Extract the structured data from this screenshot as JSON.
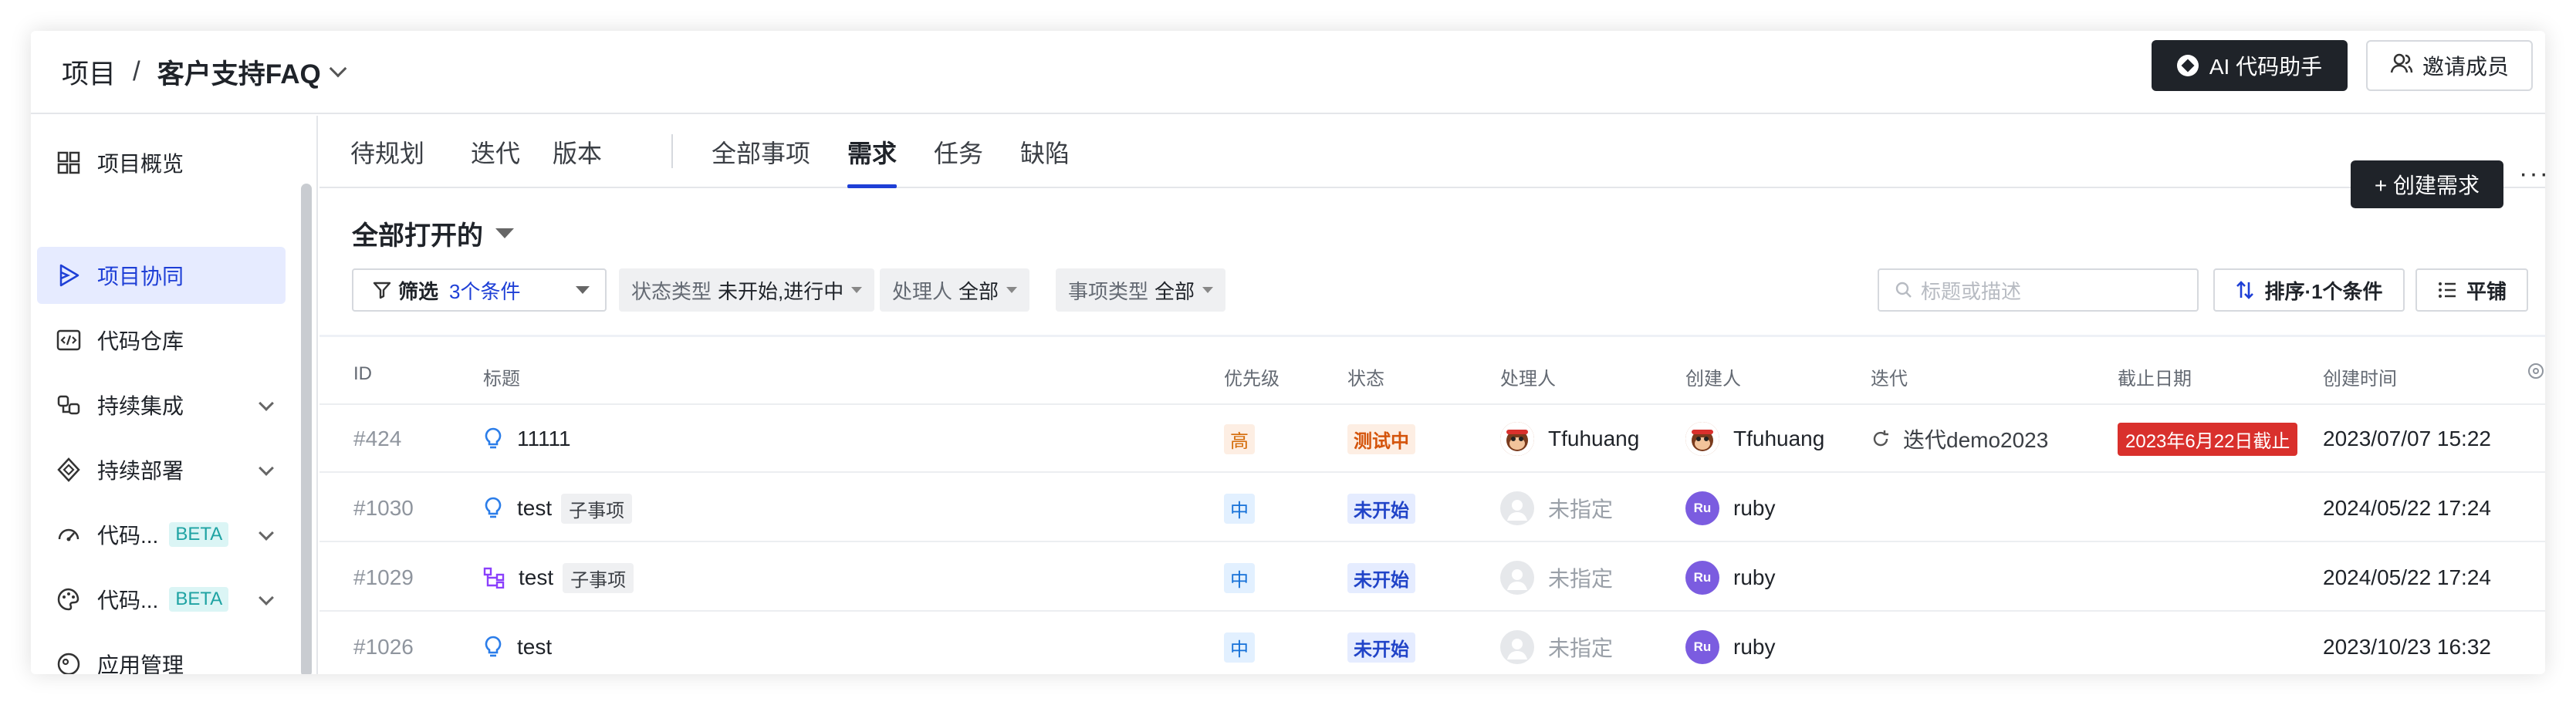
{
  "breadcrumb": {
    "root": "项目",
    "separator": "/",
    "project": "客户支持FAQ"
  },
  "header": {
    "ai_button": "AI 代码助手",
    "invite_button": "邀请成员"
  },
  "sidebar": {
    "items": [
      {
        "label": "项目概览",
        "icon": "grid-icon"
      },
      {
        "label": "项目协同",
        "icon": "collab-icon",
        "active": true
      },
      {
        "label": "代码仓库",
        "icon": "code-icon"
      },
      {
        "label": "持续集成",
        "icon": "ci-icon"
      },
      {
        "label": "持续部署",
        "icon": "cd-icon"
      },
      {
        "label": "代码...",
        "icon": "gauge-icon",
        "badge": "BETA"
      },
      {
        "label": "代码...",
        "icon": "palette-icon",
        "badge": "BETA"
      },
      {
        "label": "应用管理",
        "icon": "app-icon"
      }
    ]
  },
  "tabs": [
    {
      "label": "待规划"
    },
    {
      "label": "迭代"
    },
    {
      "label": "版本"
    },
    {
      "label": "全部事项"
    },
    {
      "label": "需求",
      "active": true
    },
    {
      "label": "任务"
    },
    {
      "label": "缺陷"
    }
  ],
  "actions": {
    "create_button": "+ 创建需求",
    "more": "···"
  },
  "view": {
    "title": "全部打开的"
  },
  "filters": {
    "filter_label": "筛选",
    "filter_count": "3个条件",
    "status_key": "状态类型",
    "status_value": "未开始,进行中",
    "assignee_key": "处理人",
    "assignee_value": "全部",
    "type_key": "事项类型",
    "type_value": "全部",
    "search_placeholder": "标题或描述",
    "sort_label": "排序·1个条件",
    "flat_label": "平铺"
  },
  "table": {
    "headers": {
      "id": "ID",
      "title": "标题",
      "priority": "优先级",
      "status": "状态",
      "assignee": "处理人",
      "creator": "创建人",
      "iteration": "迭代",
      "deadline": "截止日期",
      "created": "创建时间"
    },
    "rows": [
      {
        "id": "#424",
        "title": "11111",
        "sub_tag": "",
        "priority": "高",
        "status": "测试中",
        "assignee": "Tfuhuang",
        "creator": "Tfuhuang",
        "iteration": "迭代demo2023",
        "deadline": "2023年6月22日截止",
        "created": "2023/07/07 15:22"
      },
      {
        "id": "#1030",
        "title": "test",
        "sub_tag": "子事项",
        "priority": "中",
        "status": "未开始",
        "assignee": "未指定",
        "creator": "ruby",
        "creator_initials": "Ru",
        "iteration": "",
        "deadline": "",
        "created": "2024/05/22 17:24"
      },
      {
        "id": "#1029",
        "title": "test",
        "sub_tag": "子事项",
        "priority": "中",
        "status": "未开始",
        "assignee": "未指定",
        "creator": "ruby",
        "creator_initials": "Ru",
        "iteration": "",
        "deadline": "",
        "created": "2024/05/22 17:24"
      },
      {
        "id": "#1026",
        "title": "test",
        "sub_tag": "",
        "priority": "中",
        "status": "未开始",
        "assignee": "未指定",
        "creator": "ruby",
        "creator_initials": "Ru",
        "iteration": "",
        "deadline": "",
        "created": "2023/10/23 16:32"
      }
    ]
  },
  "colors": {
    "accent": "#1e3fd6",
    "dark_button": "#1f2329",
    "deadline_red": "#d9302c"
  }
}
